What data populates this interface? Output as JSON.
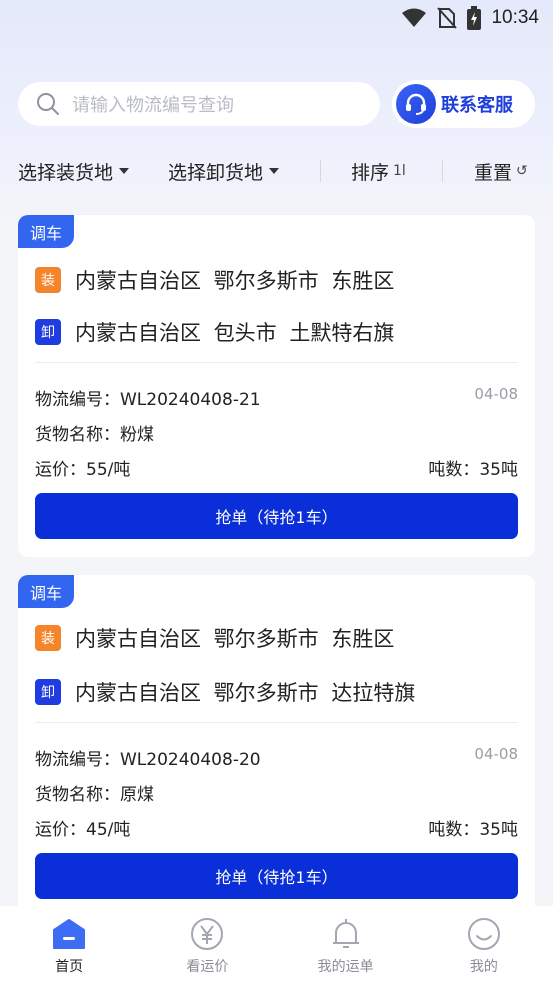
{
  "status_bar": {
    "time": "10:34"
  },
  "search": {
    "placeholder": "请输入物流编号查询"
  },
  "service": {
    "label": "联系客服"
  },
  "filters": {
    "load_place": "选择装货地",
    "unload_place": "选择卸货地",
    "sort": "排序",
    "sort_glyph": "1l",
    "reset": "重置",
    "reset_glyph": "↺"
  },
  "cards": [
    {
      "tag": "调车",
      "load_badge": "装",
      "load_route": "内蒙古自治区 鄂尔多斯市 东胜区",
      "unload_badge": "卸",
      "unload_route": "内蒙古自治区 包头市 土默特右旗",
      "logistics_no": "物流编号：WL20240408-21",
      "date": "04-08",
      "goods": "货物名称：粉煤",
      "price": "运价：55/吨",
      "tonnage": "吨数：35吨",
      "button": "抢单（待抢1车）"
    },
    {
      "tag": "调车",
      "load_badge": "装",
      "load_route": "内蒙古自治区 鄂尔多斯市 东胜区",
      "unload_badge": "卸",
      "unload_route": "内蒙古自治区 鄂尔多斯市 达拉特旗",
      "logistics_no": "物流编号：WL20240408-20",
      "date": "04-08",
      "goods": "货物名称：原煤",
      "price": "运价：45/吨",
      "tonnage": "吨数：35吨",
      "button": "抢单（待抢1车）"
    }
  ],
  "tabbar": {
    "items": [
      {
        "label": "首页",
        "icon": "home-icon",
        "active": true
      },
      {
        "label": "看运价",
        "icon": "yuan-icon",
        "active": false
      },
      {
        "label": "我的运单",
        "icon": "bell-icon",
        "active": false
      },
      {
        "label": "我的",
        "icon": "smiley-icon",
        "active": false
      }
    ]
  },
  "colors": {
    "accent": "#0a2ed8",
    "tag": "#3366f0",
    "load_badge": "#f5852a",
    "unload_badge": "#1e3ce0"
  }
}
